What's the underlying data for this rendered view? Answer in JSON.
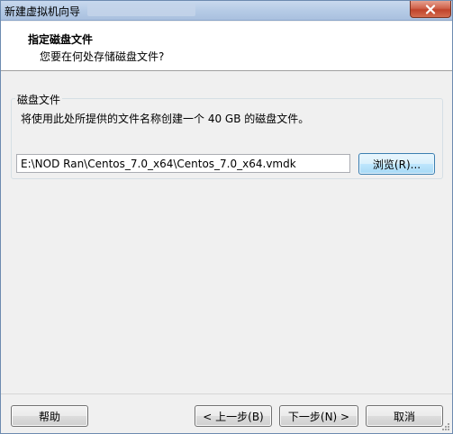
{
  "window": {
    "title": "新建虚拟机向导"
  },
  "header": {
    "title": "指定磁盘文件",
    "subtitle": "您要在何处存储磁盘文件?"
  },
  "disk_group": {
    "label": "磁盘文件",
    "description": "将使用此处所提供的文件名称创建一个 40 GB 的磁盘文件。",
    "path_value": "E:\\NOD Ran\\Centos_7.0_x64\\Centos_7.0_x64.vmdk",
    "browse_label": "浏览(R)..."
  },
  "footer": {
    "help_label": "帮助",
    "back_label": "< 上一步(B)",
    "next_label": "下一步(N) >",
    "cancel_label": "取消"
  },
  "icons": [
    "close-icon",
    "resize-grip-icon"
  ]
}
